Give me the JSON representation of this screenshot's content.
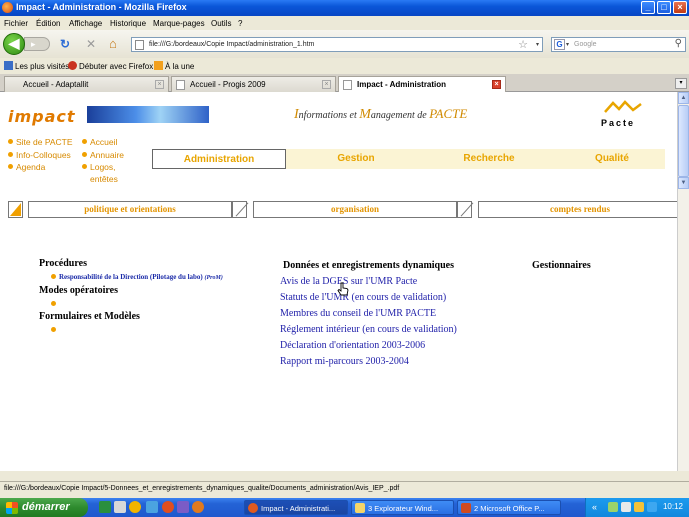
{
  "window": {
    "title": "Impact - Administration - Mozilla Firefox",
    "btn_min": "_",
    "btn_max": "□",
    "btn_close": "×"
  },
  "menu": [
    "Fichier",
    "Édition",
    "Affichage",
    "Historique",
    "Marque-pages",
    "Outils",
    "?"
  ],
  "nav": {
    "url": "file:///G:/bordeaux/Copie Impact/administration_1.htm",
    "search_placeholder": "Google",
    "search_engine_badge": "G",
    "back_arrow": "◀",
    "reload_glyph": "↻",
    "stop_glyph": "✕",
    "home_glyph": "⌂",
    "fwd_glyph": "▸",
    "star_glyph": "☆",
    "dropdown_glyph": "▾",
    "magnifier_glyph": "⚲"
  },
  "bookmarks": [
    "Les plus visités",
    "Débuter avec Firefox",
    "À la une"
  ],
  "tabs": [
    {
      "label": "Accueil - Adaptallit",
      "active": false
    },
    {
      "label": "Accueil - Progis 2009",
      "active": false
    },
    {
      "label": "Impact - Administration",
      "active": true
    }
  ],
  "tab_close_glyph": "×",
  "tab_list_glyph": "▾",
  "scroll_up_glyph": "▲",
  "scroll_down_glyph": "▼",
  "site": {
    "logo": "impact",
    "tagline": {
      "i_big": "I",
      "i_rest": "nformations et ",
      "m_big": "M",
      "m_rest": "anagement de ",
      "pacte": "PACTE"
    },
    "pacte_logo": "Pacte",
    "left_links_col1": [
      "Site de PACTE",
      "Info-Colloques",
      "Agenda"
    ],
    "left_links_col2": [
      "Accueil",
      "Annuaire",
      "Logos,",
      "entêtes"
    ],
    "main_nav": [
      "Administration",
      "Gestion",
      "Recherche",
      "Qualité"
    ],
    "sub_nav": [
      "politique et orientations",
      "organisation",
      "comptes rendus"
    ]
  },
  "left_sections": {
    "procedures": "Procédures",
    "procedures_item": "Responsabilité de la Direction (Pilotage du labo)",
    "procedures_note": "(ProM)",
    "modes": "Modes opératoires",
    "forms": "Formulaires et Modèles"
  },
  "columns": {
    "data_header": "Données et enregistrements dynamiques",
    "managers_header": "Gestionnaires"
  },
  "documents": [
    "Avis de la DGES sur l'UMR Pacte",
    "Statuts de l'UMR (en cours de validation)",
    "Membres du conseil de l'UMR PACTE",
    "Réglement intérieur (en cours de validation)",
    "Déclaration d'orientation 2003-2006",
    "Rapport mi-parcours 2003-2004"
  ],
  "status": "file:///G:/bordeaux/Copie Impact/5-Donnees_et_enregistrements_dynamiques_qualite/Documents_administration/Avis_IEP_.pdf",
  "taskbar": {
    "start": "démarrer",
    "tasks": [
      "Impact - Administrati...",
      "3 Explorateur Wind...",
      "2 Microsoft Office P..."
    ],
    "tray_expand": "«",
    "clock": "10:12"
  },
  "colors": {
    "accent": "#e8a500",
    "link": "#2222aa",
    "titlebar": "#0a56d8"
  }
}
